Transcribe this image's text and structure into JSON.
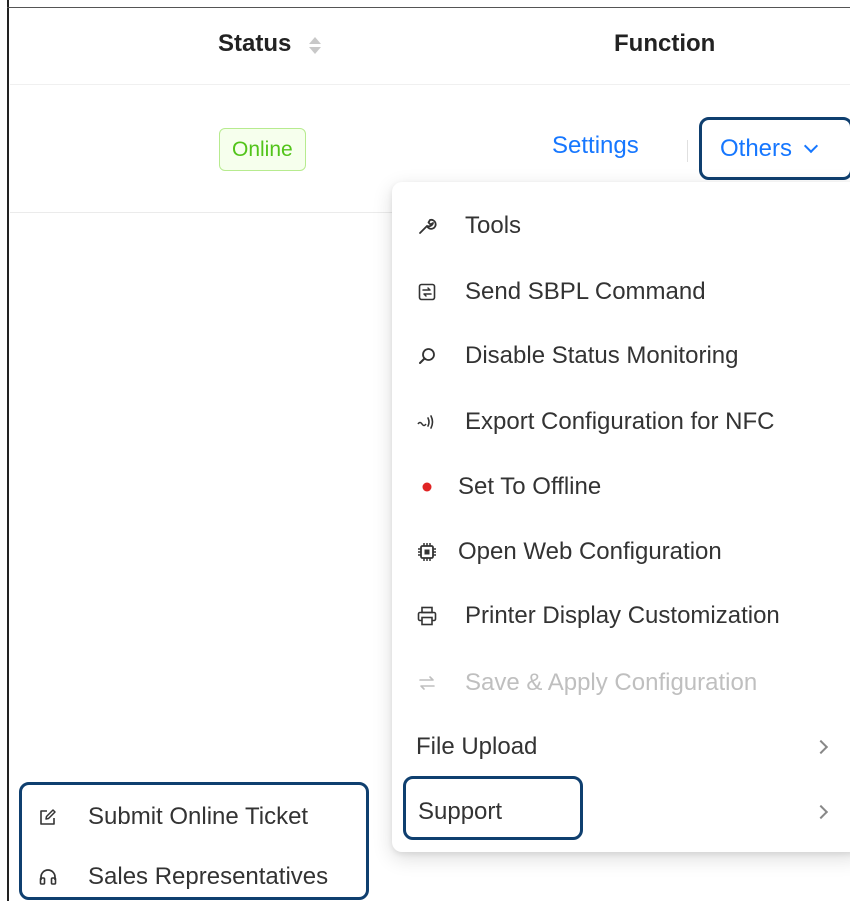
{
  "table": {
    "status_header": "Status",
    "function_header": "Function",
    "row": {
      "status_badge": "Online",
      "settings_label": "Settings",
      "others_label": "Others"
    }
  },
  "dropdown": {
    "items": [
      {
        "label": "Tools",
        "icon": "wrench-icon"
      },
      {
        "label": "Send SBPL Command",
        "icon": "command-icon"
      },
      {
        "label": "Disable Status Monitoring",
        "icon": "monitor-search-icon"
      },
      {
        "label": "Export Configuration for NFC",
        "icon": "nfc-icon"
      },
      {
        "label": "Set To Offline",
        "icon": "red-dot-icon"
      },
      {
        "label": "Open Web Configuration",
        "icon": "chip-icon"
      },
      {
        "label": "Printer Display Customization",
        "icon": "printer-icon"
      },
      {
        "label": "Save & Apply Configuration",
        "icon": "swap-icon",
        "disabled": true
      },
      {
        "label": "File Upload",
        "submenu": true
      },
      {
        "label": "Support",
        "submenu": true
      }
    ]
  },
  "support_submenu": {
    "items": [
      {
        "label": "Submit Online Ticket",
        "icon": "edit-icon"
      },
      {
        "label": "Sales Representatives",
        "icon": "headset-icon"
      }
    ]
  },
  "colors": {
    "link": "#1677ff",
    "online_text": "#52c41a",
    "online_bg": "#f6ffed",
    "online_border": "#b7eb8f",
    "highlight_border": "#0f3f6f",
    "offline_dot": "#e02424",
    "disabled_text": "#bfbfbf"
  }
}
